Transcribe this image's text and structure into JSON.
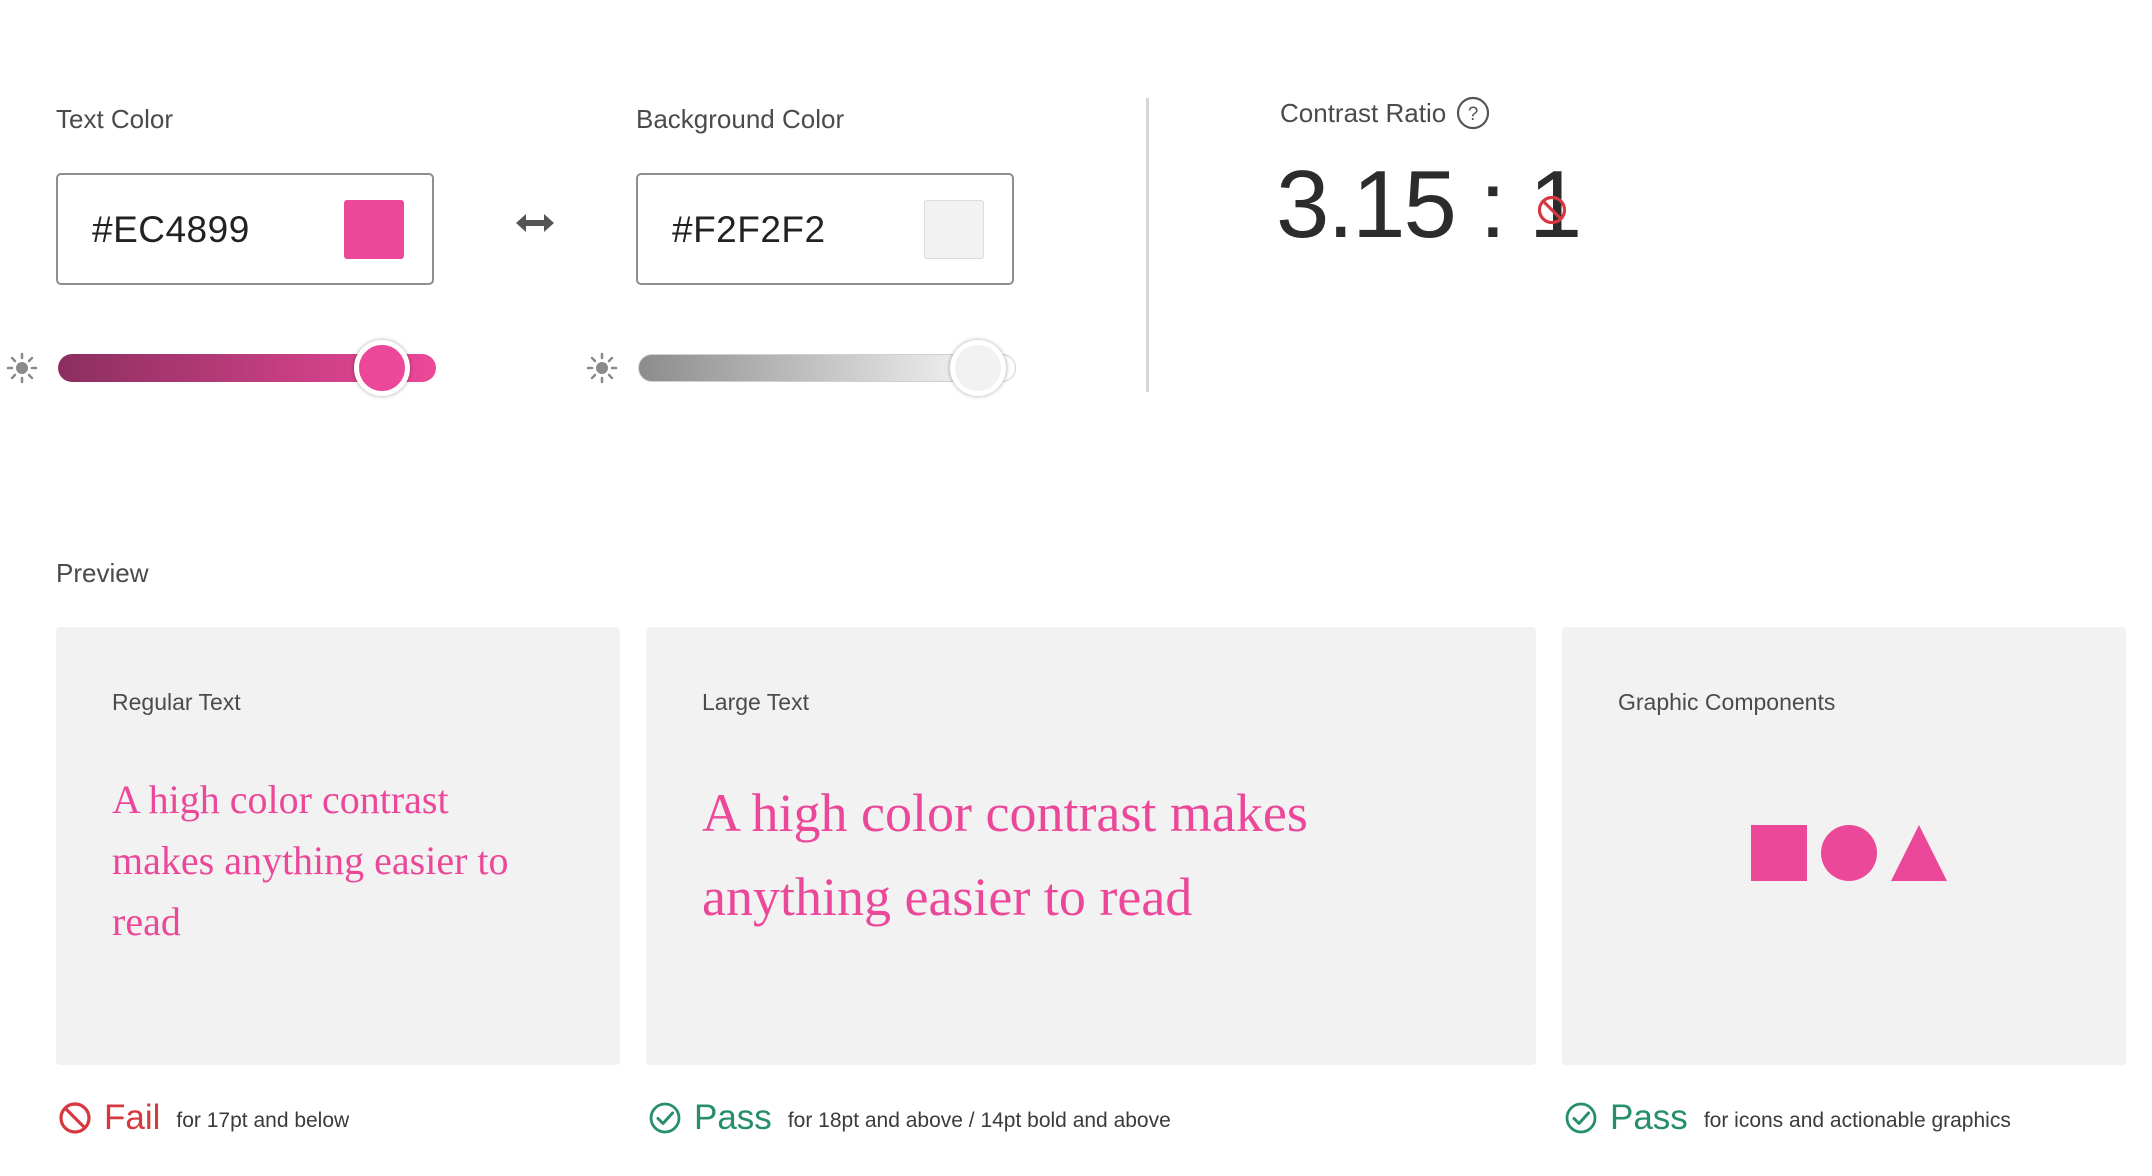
{
  "text_color": {
    "label": "Text Color",
    "hex": "#EC4899",
    "swatch": "#ec4899",
    "brightness_slider_fraction": 0.857
  },
  "swap_icon": "swap-arrows-icon",
  "background_color": {
    "label": "Background Color",
    "hex": "#F2F2F2",
    "swatch": "#f2f2f2",
    "brightness_slider_fraction": 0.9
  },
  "contrast": {
    "label": "Contrast Ratio",
    "help_icon": "question-icon",
    "value": "3.15 : 1",
    "status_icon": "fail-icon"
  },
  "preview": {
    "label": "Preview",
    "cards": [
      {
        "title": "Regular Text",
        "sample": "A high color contrast makes anything easier to read",
        "result": {
          "status": "Fail",
          "description": "for 17pt and below"
        }
      },
      {
        "title": "Large Text",
        "sample": "A high color contrast makes anything easier to read",
        "result": {
          "status": "Pass",
          "description": "for 18pt and above / 14pt bold and above"
        }
      },
      {
        "title": "Graphic Components",
        "shapes": [
          "square",
          "circle",
          "triangle"
        ],
        "result": {
          "status": "Pass",
          "description": "for icons and actionable graphics"
        }
      }
    ]
  },
  "colors": {
    "fail": "#d7373f",
    "pass": "#268e6c",
    "pink": "#ec4899",
    "pink_dark": "#8b2f5f",
    "gray_dark": "#8c8c8c"
  }
}
